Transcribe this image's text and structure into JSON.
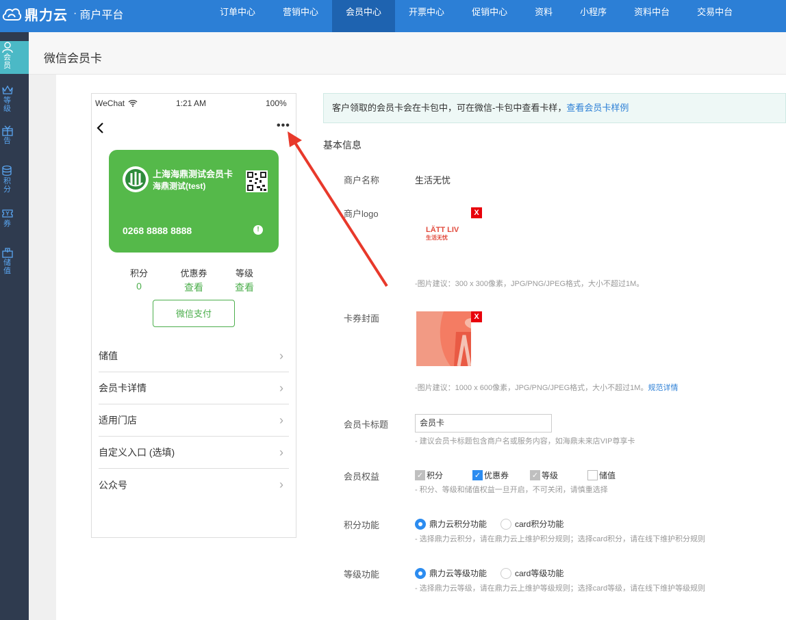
{
  "header": {
    "brand": "鼎力云",
    "separator": "·",
    "platform": "商户平台",
    "nav": [
      {
        "label": "订单中心",
        "active": false
      },
      {
        "label": "营销中心",
        "active": false
      },
      {
        "label": "会员中心",
        "active": true
      },
      {
        "label": "开票中心",
        "active": false
      },
      {
        "label": "促销中心",
        "active": false
      },
      {
        "label": "资料",
        "active": false
      },
      {
        "label": "小程序",
        "active": false
      },
      {
        "label": "资料中台",
        "active": false
      },
      {
        "label": "交易中台",
        "active": false
      }
    ]
  },
  "sidebar": {
    "items": [
      {
        "label": "会员",
        "icon": "person-icon",
        "active": true
      },
      {
        "label": "等级",
        "icon": "crown-icon",
        "active": false
      },
      {
        "label": "告",
        "icon": "gift-icon",
        "active": false
      },
      {
        "label": "积分",
        "icon": "coins-icon",
        "active": false
      },
      {
        "label": "券",
        "icon": "ticket-icon",
        "active": false
      },
      {
        "label": "储值",
        "icon": "wallet-icon",
        "active": false
      }
    ]
  },
  "page": {
    "title": "微信会员卡"
  },
  "phone": {
    "carrier": "WeChat",
    "time": "1:21 AM",
    "battery": "100%",
    "back": "‹",
    "more": "•••",
    "card": {
      "title": "上海海鼎测试会员卡",
      "subtitle": "海鼎测试(test)",
      "number": "0268 8888 8888",
      "color": "#55b94a"
    },
    "stats": [
      {
        "label": "积分",
        "value": "0"
      },
      {
        "label": "优惠券",
        "value": "查看"
      },
      {
        "label": "等级",
        "value": "查看"
      }
    ],
    "pay_button": "微信支付",
    "menu": [
      "储值",
      "会员卡详情",
      "适用门店",
      "自定义入口 (选填)",
      "公众号"
    ]
  },
  "notice": {
    "text": "客户领取的会员卡会在卡包中，可在微信-卡包中查看卡样，",
    "link": "查看会员卡样例"
  },
  "form": {
    "section_title": "基本信息",
    "merchant_name_label": "商户名称",
    "merchant_name": "生活无忧",
    "logo_label": "商户logo",
    "logo_text": "LÄTT LIV",
    "logo_subtext": "生活无忧",
    "logo_hint": "-图片建议：300 x 300像素，JPG/PNG/JPEG格式，大小不超过1M。",
    "delete_mark": "X",
    "cover_label": "卡券封面",
    "cover_hint": "-图片建议：1000 x 600像素，JPG/PNG/JPEG格式，大小不超过1M。",
    "cover_hint_link": "规范详情",
    "card_title_label": "会员卡标题",
    "card_title_value": "会员卡",
    "card_title_hint": "- 建议会员卡标题包含商户名或服务内容，如海鼎未来店VIP尊享卡",
    "benefits_label": "会员权益",
    "benefits": [
      {
        "label": "积分",
        "state": "disabled-checked"
      },
      {
        "label": "优惠券",
        "state": "checked"
      },
      {
        "label": "等级",
        "state": "disabled-checked"
      },
      {
        "label": "储值",
        "state": "unchecked"
      }
    ],
    "benefits_hint": "- 积分、等级和储值权益一旦开启，不可关闭，请慎重选择",
    "points_label": "积分功能",
    "points_options": [
      "鼎力云积分功能",
      "card积分功能"
    ],
    "points_selected": "鼎力云积分功能",
    "points_hint": "- 选择鼎力云积分，请在鼎力云上维护积分规则；选择card积分，请在线下维护积分规则",
    "level_label": "等级功能",
    "level_options": [
      "鼎力云等级功能",
      "card等级功能"
    ],
    "level_selected": "鼎力云等级功能",
    "level_hint": "- 选择鼎力云等级，请在鼎力云上维护等级规则；选择card等级，请在线下维护等级规则"
  },
  "colors": {
    "topbar": "#2c7fd6",
    "sidebar": "#2f3b4f",
    "accent": "#4cae4c",
    "annotation_arrow": "#e8392b"
  }
}
